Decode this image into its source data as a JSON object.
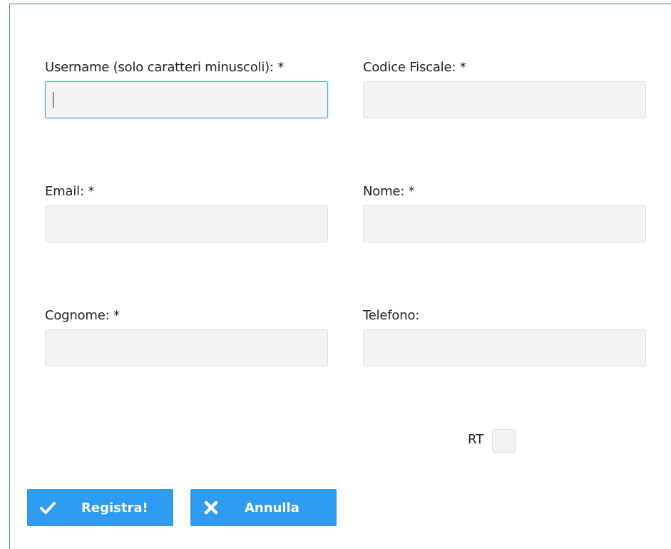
{
  "form": {
    "username_label": "Username (solo caratteri minuscoli):  *",
    "codice_fiscale_label": "Codice Fiscale:  *",
    "email_label": "Email:  *",
    "nome_label": "Nome:  *",
    "cognome_label": "Cognome:  *",
    "telefono_label": "Telefono:",
    "username_value": "",
    "codice_fiscale_value": "",
    "email_value": "",
    "nome_value": "",
    "cognome_value": "",
    "telefono_value": "",
    "rt_label": "RT"
  },
  "actions": {
    "register_label": "Registra!",
    "register_icon": "check-icon",
    "cancel_label": "Annulla",
    "cancel_icon": "close-icon"
  },
  "colors": {
    "accent": "#2f9bf0",
    "focus_border": "#4d9be8",
    "field_bg": "#f3f3f3",
    "frame_border": "#4a7fc1"
  }
}
